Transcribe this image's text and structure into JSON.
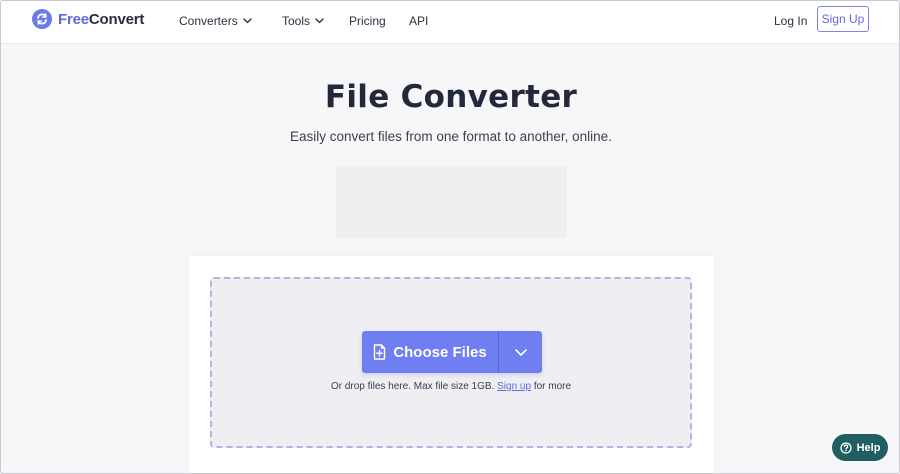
{
  "brand": {
    "name_part1": "Free",
    "name_part2": "Convert",
    "accent_color": "#6b79e9"
  },
  "nav": {
    "items": [
      {
        "label": "Converters",
        "has_dropdown": true
      },
      {
        "label": "Tools",
        "has_dropdown": true
      },
      {
        "label": "Pricing",
        "has_dropdown": false
      },
      {
        "label": "API",
        "has_dropdown": false
      }
    ],
    "login_label": "Log In",
    "signup_label": "Sign Up"
  },
  "hero": {
    "title": "File Converter",
    "subtitle": "Easily convert files from one format to another, online."
  },
  "upload": {
    "choose_label": "Choose Files",
    "hint_prefix": "Or drop files here. Max file size 1GB.",
    "hint_link": "Sign up",
    "hint_suffix": "for more",
    "button_color": "#6f7ef0"
  },
  "help": {
    "label": "Help",
    "color": "#1f5f62"
  }
}
